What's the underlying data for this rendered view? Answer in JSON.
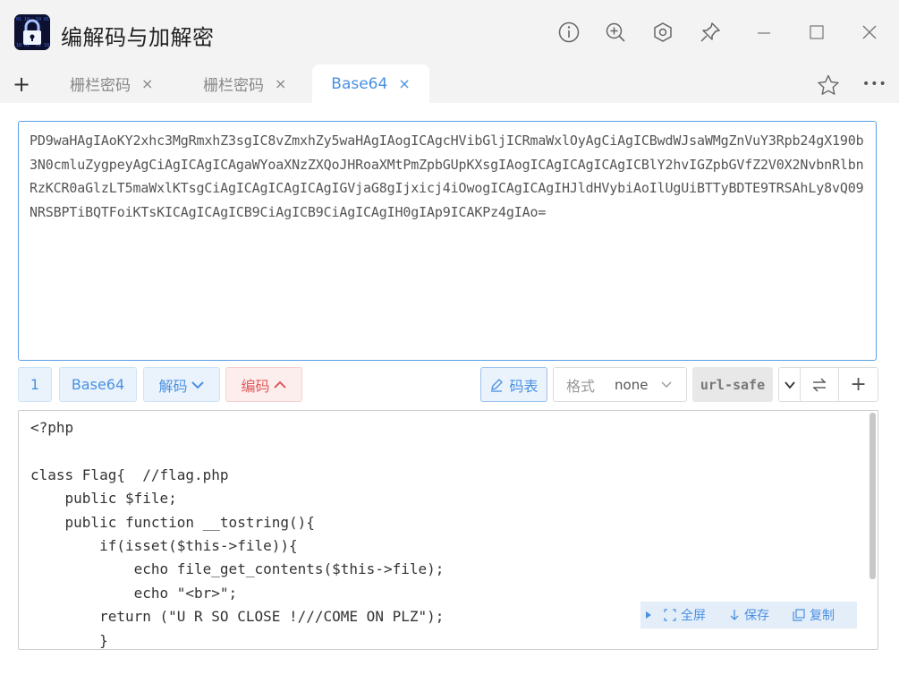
{
  "window": {
    "title": "编解码与加解密",
    "buttons": [
      "info-icon",
      "zoom-in-icon",
      "settings-icon",
      "pin-icon",
      "minimize-icon",
      "maximize-icon",
      "close-icon"
    ]
  },
  "tabs": {
    "add_label": "+",
    "items": [
      {
        "label": "栅栏密码",
        "close": "×",
        "active": false
      },
      {
        "label": "栅栏密码",
        "close": "×",
        "active": false
      },
      {
        "label": "Base64",
        "close": "×",
        "active": true
      }
    ],
    "favorite_icon": "star-icon",
    "more_label": "•••"
  },
  "input": {
    "value": "PD9waHAgIAoKY2xhc3MgRmxhZ3sgIC8vZmxhZy5waHAgIAogICAgcHVibGljICRmaWxlOyAgCiAgICBwdWJsaWMgZnVuY3Rpb24gX190b3N0cmluZygpeyAgCiAgICAgICAgaWYoaXNzZXQoJHRoaXMtPmZpbGUpKXsgIAogICAgICAgICAgICBlY2hvIGZpbGVfZ2V0X2NvbnRlbnRzKCR0aGlzLT5maWxlKTsgCiAgICAgICAgICAgIGVjaG8gIjxicj4iOwogICAgICAgIHJldHVybiAoIlUgUiBTTyBDTE9TRSAhLy8vQ09NRSBPTiBQTFoiKTsKICAgICAgICB9CiAgICB9CiAgICAgIH0gIAp9ICAKPz4gIAo="
  },
  "toolbar": {
    "count": "1",
    "mode": "Base64",
    "decode_label": "解码",
    "encode_label": "编码",
    "codebook_label": "码表",
    "format_label": "格式",
    "format_value": "none",
    "urlsafe_label": "url-safe",
    "plus_label": "+"
  },
  "output": {
    "lines": [
      "<?php",
      "",
      "class Flag{  //flag.php",
      "    public $file;",
      "    public function __tostring(){",
      "        if(isset($this->file)){",
      "            echo file_get_contents($this->file);",
      "            echo \"<br>\";",
      "        return (\"U R SO CLOSE !///COME ON PLZ\");",
      "        }"
    ],
    "fullscreen_label": "全屏",
    "save_label": "保存",
    "copy_label": "复制"
  }
}
